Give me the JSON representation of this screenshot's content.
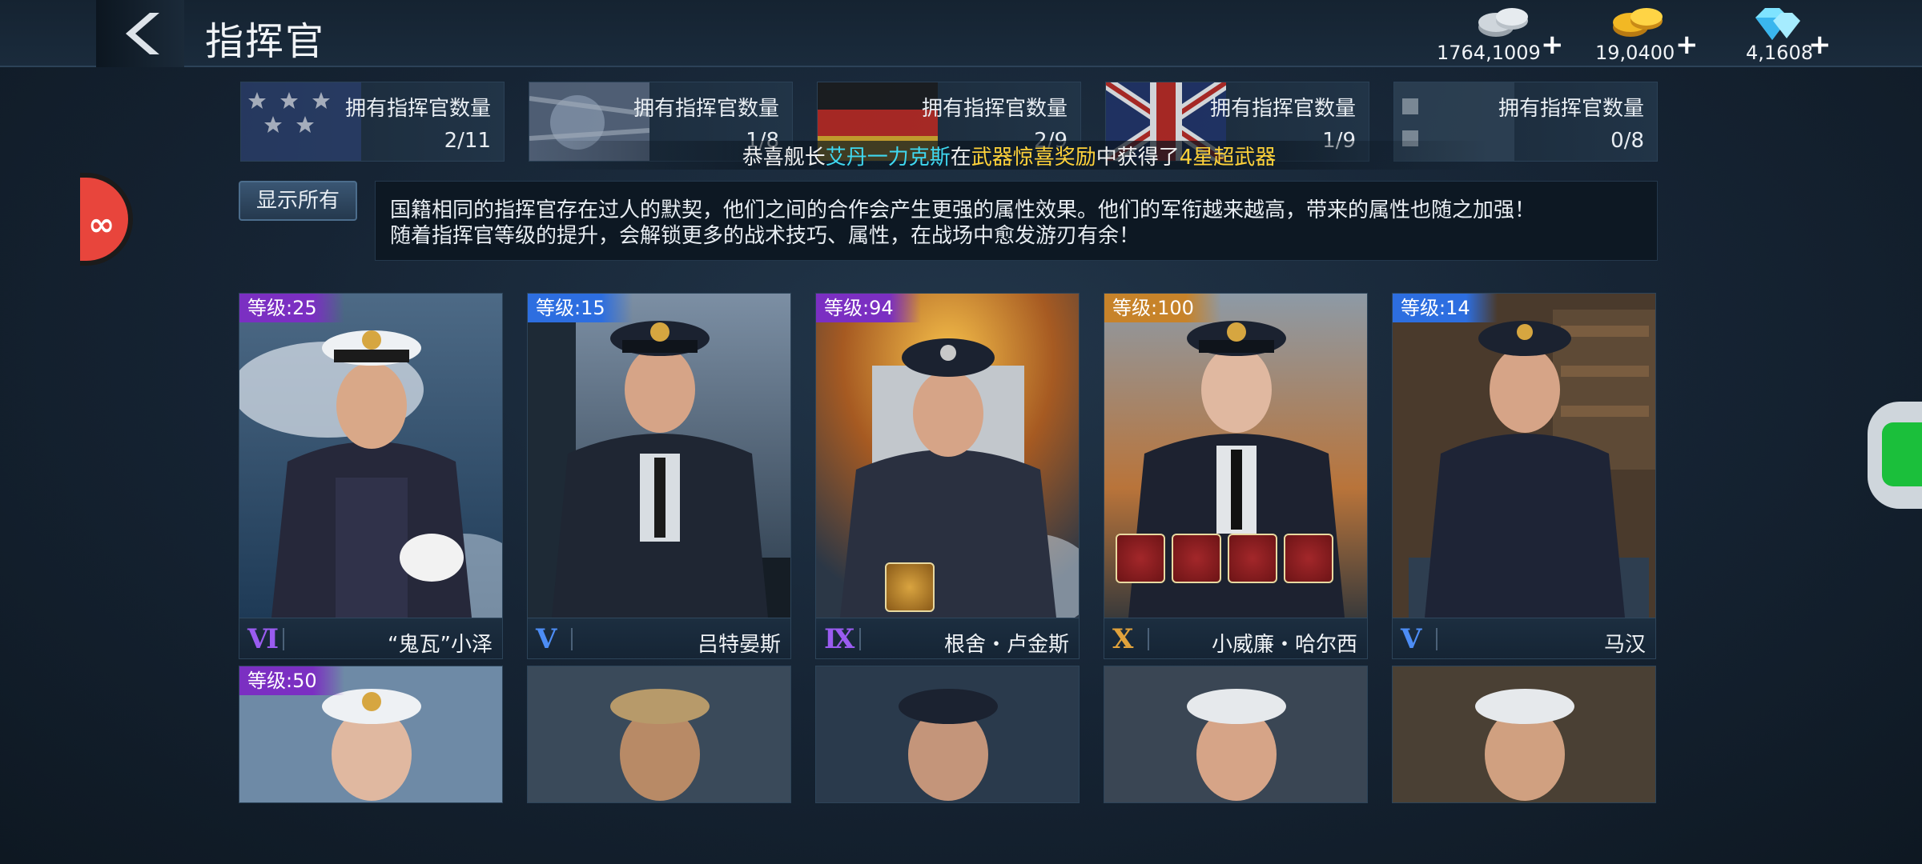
{
  "header": {
    "title": "指挥官",
    "currencies": [
      {
        "name": "silver-coins-icon",
        "value": "1764,1009",
        "plus": "+"
      },
      {
        "name": "gold-coins-icon",
        "value": "19,0400",
        "plus": "+"
      },
      {
        "name": "diamond-icon",
        "value": "4,1608",
        "plus": "+"
      }
    ]
  },
  "nations": [
    {
      "label": "拥有指挥官数量",
      "count": "2/11",
      "flag": "usa"
    },
    {
      "label": "拥有指挥官数量",
      "count": "1/8",
      "flag": "japan"
    },
    {
      "label": "拥有指挥官数量",
      "count": "2/9",
      "flag": "germany"
    },
    {
      "label": "拥有指挥官数量",
      "count": "1/9",
      "flag": "uk"
    },
    {
      "label": "拥有指挥官数量",
      "count": "0/8",
      "flag": "ussr"
    }
  ],
  "announcement": {
    "prefix": "恭喜舰长",
    "player": "艾丹一力克斯",
    "middle": "在",
    "event": "武器惊喜奖励",
    "middle2": "中获得了",
    "reward": "4星超武器"
  },
  "show_all_label": "显示所有",
  "description": {
    "line1": "国籍相同的指挥官存在过人的默契，他们之间的合作会产生更强的属性效果。他们的军衔越来越高，带来的属性也随之加强！",
    "line2": "随着指挥官等级的提升，会解锁更多的战术技巧、属性，在战场中愈发游刃有余！"
  },
  "commanders": [
    {
      "level": "等级:25",
      "rank": "Ⅵ",
      "name": "“鬼瓦”小泽",
      "level_color": "purple",
      "rank_color": "#9a5cf0",
      "equipment": []
    },
    {
      "level": "等级:15",
      "rank": "Ⅴ",
      "name": "吕特晏斯",
      "level_color": "blue",
      "rank_color": "#4d8df5",
      "equipment": []
    },
    {
      "level": "等级:94",
      "rank": "Ⅸ",
      "name": "根舍・卢金斯",
      "level_color": "purple",
      "rank_color": "#9a5cf0",
      "equipment": [
        "dagger-icon"
      ]
    },
    {
      "level": "等级:100",
      "rank": "Ⅹ",
      "name": "小威廉・哈尔西",
      "level_color": "gold",
      "rank_color": "#e0a23c",
      "equipment": [
        "skull-icon",
        "binoculars-icon",
        "uniform-icon",
        "pocket-watch-icon"
      ]
    },
    {
      "level": "等级:14",
      "rank": "Ⅴ",
      "name": "马汉",
      "level_color": "blue",
      "rank_color": "#4d8df5",
      "equipment": []
    }
  ],
  "commanders_row2": [
    {
      "level": "等级:50",
      "level_color": "purple"
    },
    {
      "level": "",
      "level_color": ""
    },
    {
      "level": "",
      "level_color": ""
    },
    {
      "level": "",
      "level_color": ""
    },
    {
      "level": "",
      "level_color": ""
    }
  ],
  "colors": {
    "accent_cyan": "#3fd8f0",
    "accent_gold": "#ffd23a",
    "purple_tier": "#7b2fc2",
    "blue_tier": "#2d6ee0",
    "gold_tier": "#c7832a"
  }
}
